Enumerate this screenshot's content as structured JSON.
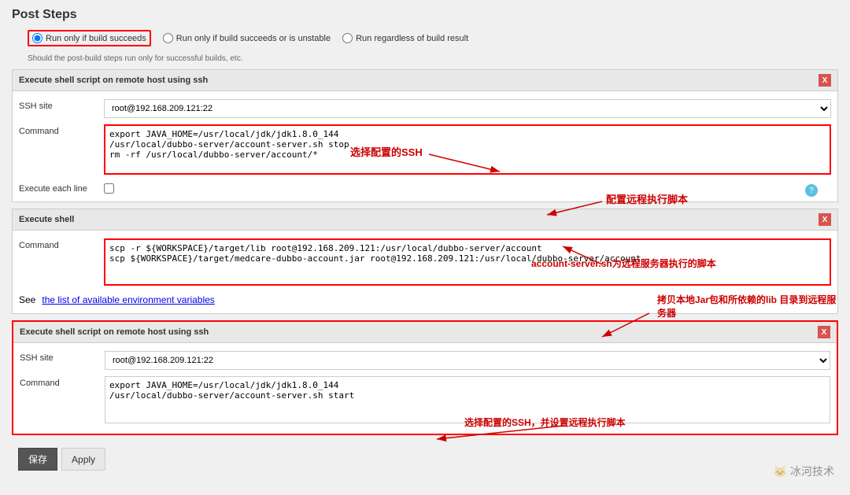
{
  "page": {
    "title": "Post Steps"
  },
  "radio_group": {
    "option1_label": "Run only if build succeeds",
    "option2_label": "Run only if build succeeds or is unstable",
    "option3_label": "Run regardless of build result",
    "hint": "Should the post-build steps run only for successful builds, etc."
  },
  "section1": {
    "header": "Execute shell script on remote host using ssh",
    "ssh_label": "SSH site",
    "ssh_value": "root@192.168.209.121:22",
    "command_label": "Command",
    "command_value": "export JAVA_HOME=/usr/local/jdk/jdk1.8.0_144\n/usr/local/dubbo-server/account-server.sh stop\nrm -rf /usr/local/dubbo-server/account/*",
    "execute_each_label": "Execute each line",
    "close_label": "X"
  },
  "section2": {
    "header": "Execute shell",
    "command_label": "Command",
    "command_value": "scp -r ${WORKSPACE}/target/lib root@192.168.209.121:/usr/local/dubbo-server/account\nscp ${WORKSPACE}/target/medcare-dubbo-account.jar root@192.168.209.121:/usr/local/dubbo-server/account",
    "env_vars_text": "See ",
    "env_vars_link": "the list of available environment variables",
    "close_label": "X"
  },
  "section3": {
    "header": "Execute shell script on remote host using ssh",
    "ssh_label": "SSH site",
    "ssh_value": "root@192.168.209.121:22",
    "command_label": "Command",
    "command_value": "export JAVA_HOME=/usr/local/jdk/jdk1.8.0_144\n/usr/local/dubbo-server/account-server.sh start",
    "close_label": "X"
  },
  "annotations": {
    "ann1": "选择配置的SSH",
    "ann2": "配置远程执行脚本",
    "ann3": "account-server.sh为远程服务器执行的脚本",
    "ann4": "拷贝本地Jar包和所依赖的lib\n目录到远程服务器",
    "ann5": "选择配置的SSH，并设置远程执行脚本"
  },
  "toolbar": {
    "save_label": "保存",
    "apply_label": "Apply"
  },
  "watermark": "冰河技术"
}
